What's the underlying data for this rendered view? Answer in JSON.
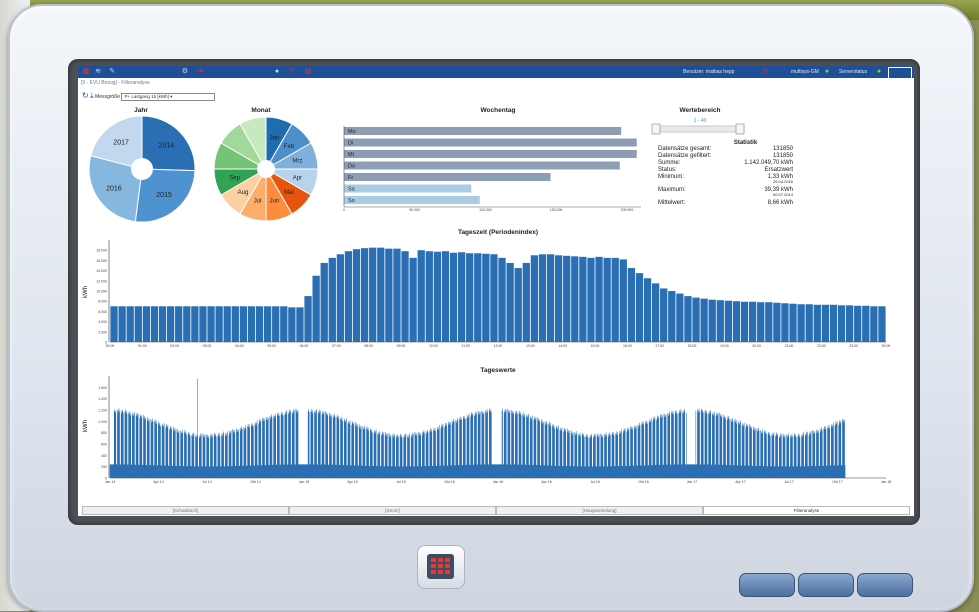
{
  "topbar": {
    "user_label": "Benutzer: mattias hepp",
    "multisys_label": "multisys-GM",
    "server_label": "Serverstatus"
  },
  "breadcrumb": "[9 - EVU Bezug] - Filteranalyse",
  "toolbar": {
    "messgroesse_label": "Messgröße",
    "select_value": "P+ Lastgang 15 [kWh]"
  },
  "jahr": {
    "title": "Jahr",
    "labels": [
      "2014",
      "2015",
      "2016",
      "2017"
    ],
    "values": [
      25.5,
      26.5,
      27,
      21
    ],
    "colors": [
      "#2a6fb3",
      "#4e93cf",
      "#86b8df",
      "#c1d8ee"
    ]
  },
  "monat": {
    "title": "Monat",
    "labels": [
      "Jan",
      "Feb",
      "Mrz",
      "Apr",
      "Mai",
      "Jun",
      "Jul",
      "Aug",
      "Sep",
      "",
      ""
    ],
    "values": [
      8.33,
      8.33,
      8.33,
      8.33,
      8.33,
      8.33,
      8.33,
      8.33,
      8.33,
      8.33,
      8.33,
      8.33
    ],
    "colors": [
      "#1f6cb0",
      "#4d8fcb",
      "#7fb0dc",
      "#b8d4ec",
      "#e6550d",
      "#fd8d3c",
      "#fdae6b",
      "#fdd0a2",
      "#31a354",
      "#74c476",
      "#a1d99b",
      "#c7e9c0"
    ]
  },
  "wochentag": {
    "title": "Wochentag",
    "days": [
      "Mo",
      "Di",
      "Mi",
      "Do",
      "Fr",
      "Sa",
      "So"
    ],
    "values": [
      196000,
      207000,
      207000,
      195000,
      146000,
      90000,
      96000
    ],
    "colors": [
      "#8c9db4",
      "#8c9db4",
      "#8c9db4",
      "#8c9db4",
      "#8c9db4",
      "#a9cbe6",
      "#a9cbe6"
    ],
    "ticks": [
      "0",
      "50.000",
      "100.000",
      "150.000",
      "200.000"
    ]
  },
  "wertebereich": {
    "title": "Wertebereich",
    "range": "1 - 40"
  },
  "statistik": {
    "title": "Statistik",
    "rows": [
      {
        "label": "Datensätze gesamt:",
        "value": "131850"
      },
      {
        "label": "Datensätze gefiltert:",
        "value": "131850"
      },
      {
        "label": "Summe:",
        "value": "1.142.049,70 kWh"
      },
      {
        "label": "Status:",
        "value": "Ersatzwert"
      },
      {
        "label": "Minimum:",
        "value": "1,33 kWh",
        "sub": "25.04.2016"
      },
      {
        "label": "Maximum:",
        "value": "39,39 kWh",
        "sub": "00.07.2014"
      },
      {
        "label": "Mittelwert:",
        "value": "8,66 kWh"
      }
    ]
  },
  "chart_data": [
    {
      "type": "bar",
      "title": "Tageszeit (Periodenindex)",
      "ylabel": "kWh",
      "ylim": [
        0,
        20000
      ],
      "yticks": [
        "0",
        "2.000",
        "4.000",
        "6.000",
        "8.000",
        "10.000",
        "12.000",
        "14.000",
        "16.000",
        "18.000"
      ],
      "xticks": [
        "00:00",
        "01:00",
        "02:00",
        "03:00",
        "04:00",
        "05:00",
        "06:00",
        "07:00",
        "08:00",
        "09:00",
        "10:00",
        "11:00",
        "12:00",
        "13:00",
        "14:00",
        "15:00",
        "16:00",
        "17:00",
        "18:00",
        "19:00",
        "20:00",
        "21:00",
        "22:00",
        "23:00",
        "00:00"
      ],
      "values": [
        7000,
        7000,
        7000,
        7000,
        7000,
        7000,
        7000,
        7000,
        7000,
        7000,
        7000,
        7000,
        7000,
        7000,
        7000,
        7000,
        7000,
        7000,
        7000,
        7000,
        7000,
        7000,
        6800,
        6800,
        9000,
        13000,
        15500,
        16500,
        17200,
        17800,
        18200,
        18400,
        18500,
        18500,
        18300,
        18300,
        17800,
        16500,
        18000,
        17800,
        17700,
        17800,
        17500,
        17600,
        17400,
        17400,
        17300,
        17200,
        16500,
        15500,
        14500,
        15500,
        17000,
        17200,
        17200,
        17000,
        16900,
        16800,
        16700,
        16500,
        16700,
        16500,
        16500,
        16200,
        14500,
        13500,
        12500,
        11500,
        10500,
        10000,
        9500,
        9000,
        8700,
        8500,
        8300,
        8200,
        8100,
        8000,
        7900,
        7900,
        7800,
        7800,
        7700,
        7600,
        7500,
        7400,
        7400,
        7300,
        7300,
        7300,
        7200,
        7200,
        7100,
        7100,
        7000,
        7000
      ]
    },
    {
      "type": "bar",
      "title": "Tageswerte",
      "ylabel": "kWh",
      "ylim": [
        0,
        1800
      ],
      "yticks": [
        "0",
        "200",
        "400",
        "600",
        "800",
        "1.000",
        "1.200",
        "1.400",
        "1.600"
      ],
      "xticks": [
        "Jan 14",
        "Apr 14",
        "Jul 14",
        "Okt 14",
        "Jan 15",
        "Apr 15",
        "Jul 15",
        "Okt 15",
        "Jan 16",
        "Apr 16",
        "Jul 16",
        "Okt 16",
        "Jan 17",
        "Apr 17",
        "Jul 17",
        "Okt 17",
        "Jan 18"
      ]
    }
  ],
  "tabs": [
    "[Schwabach]",
    "[Strom]",
    "[Hauptverteilung]",
    "Filteranalyse"
  ]
}
